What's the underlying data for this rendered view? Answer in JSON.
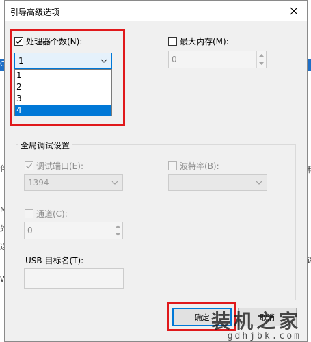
{
  "dialog": {
    "title": "引导高级选项"
  },
  "processors": {
    "label": "处理器个数(N):",
    "checked": true,
    "selected": "1",
    "options": [
      "1",
      "2",
      "3",
      "4"
    ],
    "highlighted_option": "4"
  },
  "max_memory": {
    "label": "最大内存(M):",
    "checked": false,
    "value": "0"
  },
  "debug_group": {
    "title": "全局调试设置",
    "debug_port": {
      "label": "调试端口(E):",
      "checked": true,
      "value": "1394"
    },
    "baud_rate": {
      "label": "波特率(B):",
      "checked": false,
      "value": ""
    },
    "channel": {
      "label": "通道(C):",
      "checked": false,
      "value": "0"
    },
    "usb_target": {
      "label": "USB 目标名(T):",
      "value": ""
    }
  },
  "buttons": {
    "ok": "确定",
    "cancel": "取消"
  },
  "background_window": {
    "fragments": [
      "C",
      "伴",
      "M",
      "外",
      "通",
      "W",
      "利",
      "设"
    ]
  },
  "watermark": {
    "main": "装机之家",
    "sub": "gdhjbk.com"
  },
  "colors": {
    "accent": "#0078d7",
    "highlight_box": "#e0191b"
  }
}
